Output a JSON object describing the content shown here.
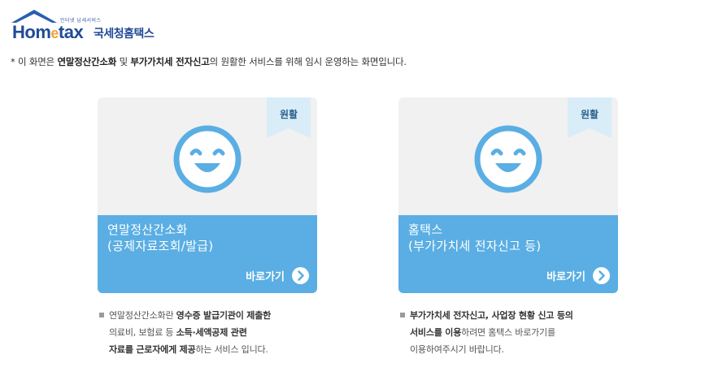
{
  "header": {
    "tagline": "인터넷 납세서비스",
    "brand_prefix": "Hom",
    "brand_e": "e",
    "brand_suffix": "tax",
    "korean_name": "국세청홈택스"
  },
  "notice": {
    "prefix": "* 이 화면은 ",
    "bold1": "연말정산간소화",
    "mid1": " 및 ",
    "bold2": "부가가치세 전자신고",
    "suffix": "의 원활한 서비스를 위해 임시 운영하는 화면입니다."
  },
  "cards": [
    {
      "badge": "원활",
      "title_line1": "연말정산간소화",
      "title_line2": "(공제자료조회/발급)",
      "button": "바로가기",
      "desc": {
        "l1_plain": "연말정산간소화란 ",
        "l1_bold": "영수증 발급기관이 제출한",
        "l2_plain": "의료비, 보험료 등 ",
        "l2_bold": "소득·세액공제 관련",
        "l3_bold": "자료를 근로자에게 제공",
        "l3_plain": "하는 서비스 입니다."
      }
    },
    {
      "badge": "원활",
      "title_line1": "홈택스",
      "title_line2": "(부가가치세 전자신고 등)",
      "button": "바로가기",
      "desc": {
        "l1_bold": "부가가치세 전자신고, 사업장 현황 신고 등의",
        "l2_bold": "서비스를 이용",
        "l2_plain": "하려면 홈택스 바로가기를",
        "l3_plain": "이용하여주시기 바랍니다."
      }
    }
  ],
  "colors": {
    "brand_blue": "#1f4a97",
    "card_blue": "#5aaee3",
    "card_gray": "#f1f1f1",
    "badge_bg": "#d9edf8"
  },
  "icons": [
    "house-roof-icon",
    "smiley-icon",
    "arrow-right-circle-icon"
  ]
}
